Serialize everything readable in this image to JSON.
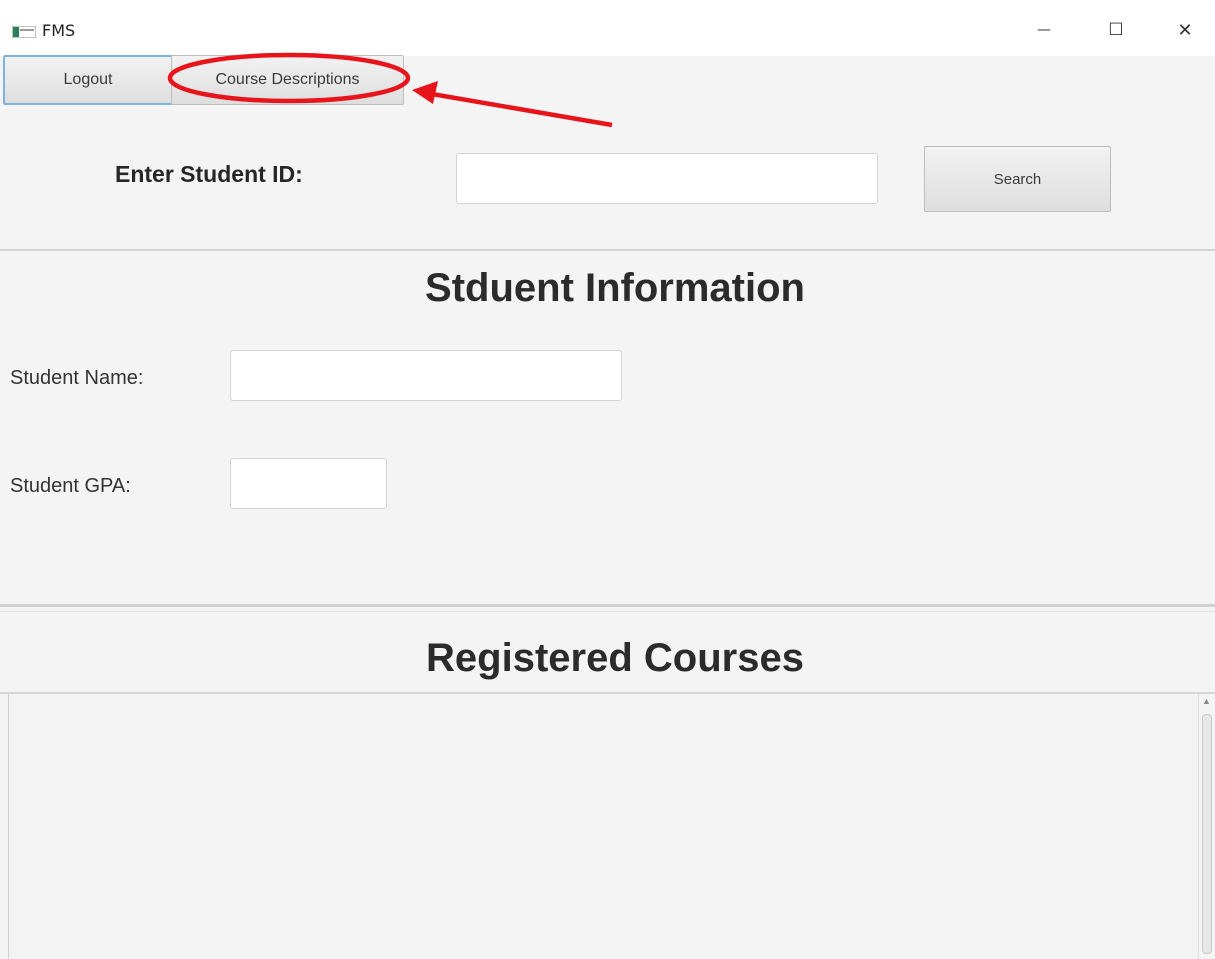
{
  "window": {
    "title": "FMS",
    "controls": {
      "minimize": "—",
      "maximize": "☐",
      "close": "✕"
    }
  },
  "toolbar": {
    "logout_label": "Logout",
    "course_descriptions_label": "Course Descriptions"
  },
  "search": {
    "label": "Enter Student ID:",
    "value": "",
    "button_label": "Search"
  },
  "student_info": {
    "heading": "Stduent Information",
    "name_label": "Student Name:",
    "name_value": "",
    "gpa_label": "Student GPA:",
    "gpa_value": ""
  },
  "courses": {
    "heading": "Registered Courses",
    "items": []
  },
  "annotation": {
    "color": "#e8141b",
    "highlight_target": "Course Descriptions"
  }
}
